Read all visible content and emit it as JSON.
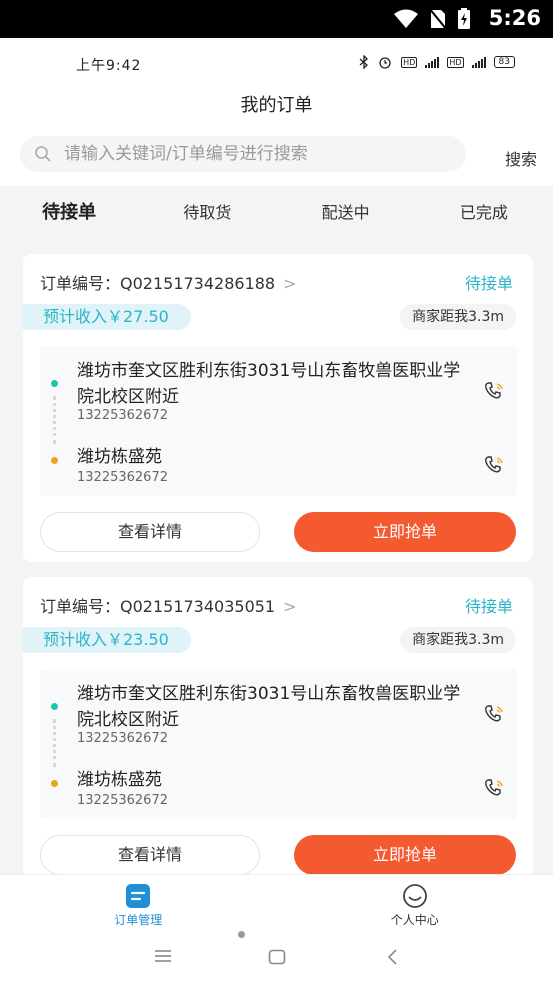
{
  "status_bar": {
    "time": "5:26"
  },
  "phone_bar": {
    "time": "上午9:42",
    "battery": "83"
  },
  "header": {
    "title": "我的订单",
    "search_placeholder": "请输入关键词/订单编号进行搜索",
    "search_button": "搜索"
  },
  "tabs": [
    {
      "label": "待接单",
      "active": true
    },
    {
      "label": "待取货",
      "active": false
    },
    {
      "label": "配送中",
      "active": false
    },
    {
      "label": "已完成",
      "active": false
    }
  ],
  "orders": [
    {
      "order_no": "订单编号：Q02151734286188",
      "status": "待接单",
      "income": "预计收入￥27.50",
      "distance": "商家距我3.3m",
      "from_address": "潍坊市奎文区胜利东街3031号山东畜牧兽医职业学院北校区附近",
      "from_phone": "13225362672",
      "to_address": "潍坊栋盛苑",
      "to_phone": "13225362672",
      "detail_button": "查看详情",
      "grab_button": "立即抢单"
    },
    {
      "order_no": "订单编号：Q02151734035051",
      "status": "待接单",
      "income": "预计收入￥23.50",
      "distance": "商家距我3.3m",
      "from_address": "潍坊市奎文区胜利东街3031号山东畜牧兽医职业学院北校区附近",
      "from_phone": "13225362672",
      "to_address": "潍坊栋盛苑",
      "to_phone": "13225362672",
      "detail_button": "查看详情",
      "grab_button": "立即抢单"
    }
  ],
  "bottom_nav": [
    {
      "label": "订单管理",
      "active": true
    },
    {
      "label": "个人中心",
      "active": false
    }
  ],
  "colors": {
    "accent": "#2bb5c8",
    "grab": "#f35a30",
    "nav_active": "#1f8fd6"
  }
}
